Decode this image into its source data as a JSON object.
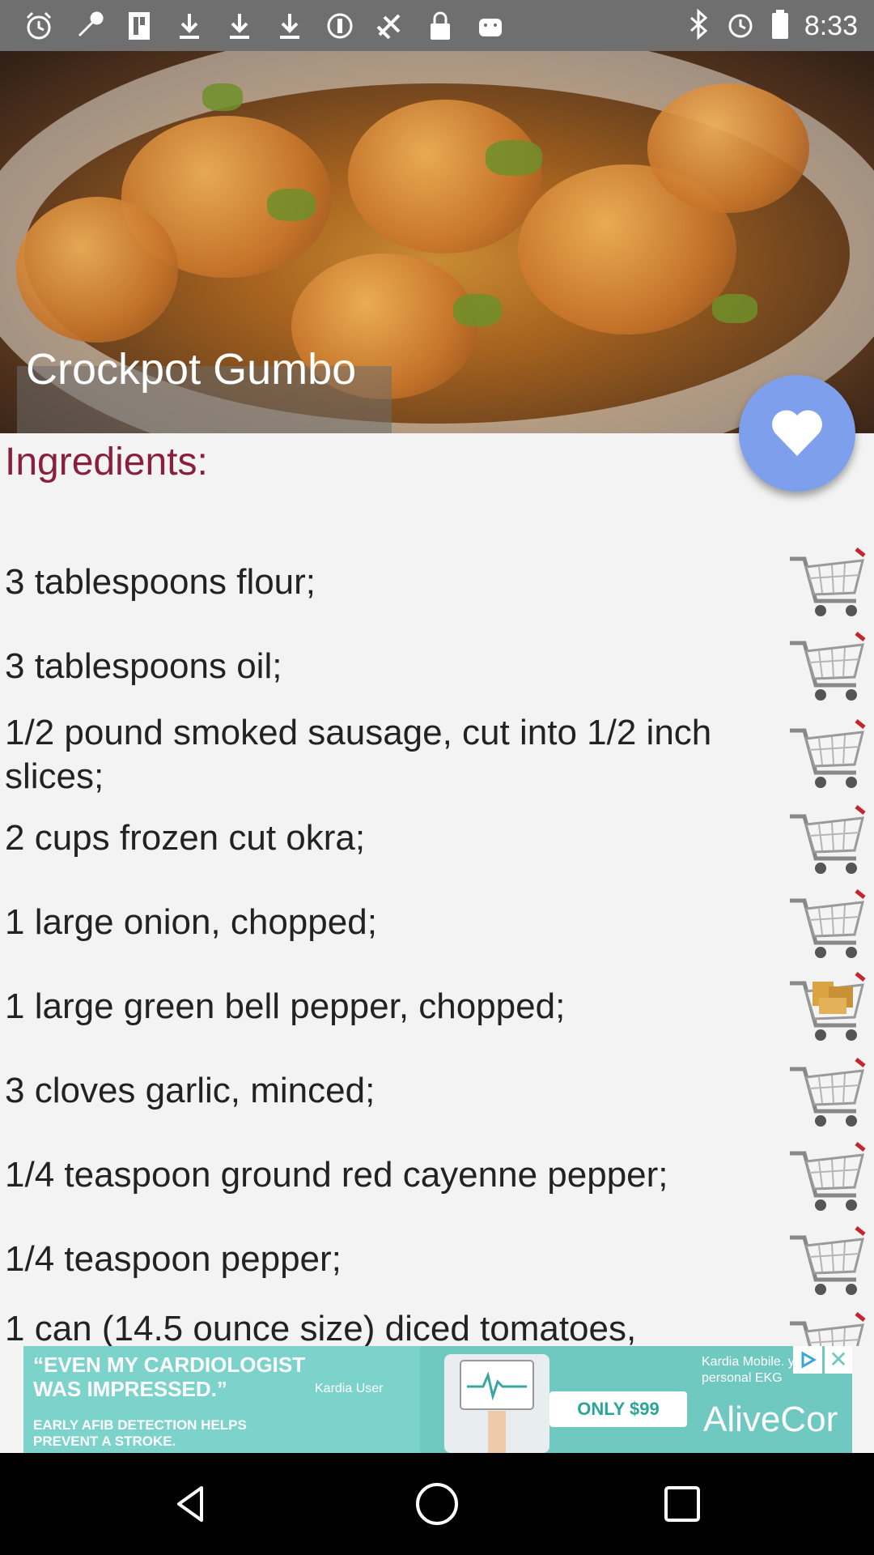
{
  "status_bar": {
    "time": "8:33",
    "icons": [
      "alarm-icon",
      "wrench-icon",
      "file-icon",
      "download-icon",
      "download-icon",
      "download-icon",
      "sync-icon",
      "fake-gps-icon",
      "lock-icon",
      "android-icon"
    ],
    "right_icons": [
      "bluetooth-icon",
      "alarm-icon",
      "battery-icon"
    ]
  },
  "hero": {
    "title": "Crockpot Gumbo",
    "favorite_icon": "heart-icon",
    "favorite_color": "#7ea0ec"
  },
  "ingredients": {
    "heading": "Ingredients:",
    "heading_color": "#8a1f3c",
    "items": [
      {
        "text": "3 tablespoons flour;",
        "icon": "shopping-cart-icon"
      },
      {
        "text": "3 tablespoons oil;",
        "icon": "shopping-cart-icon"
      },
      {
        "text": "1/2 pound smoked sausage, cut into 1/2 inch slices;",
        "icon": "shopping-cart-icon"
      },
      {
        "text": "2 cups frozen cut okra;",
        "icon": "shopping-cart-icon"
      },
      {
        "text": "1 large onion, chopped;",
        "icon": "shopping-cart-icon"
      },
      {
        "text": "1 large green bell pepper, chopped;",
        "icon": "full-shopping-cart-icon"
      },
      {
        "text": "3 cloves garlic, minced;",
        "icon": "shopping-cart-icon"
      },
      {
        "text": "1/4 teaspoon ground red cayenne pepper;",
        "icon": "shopping-cart-icon"
      },
      {
        "text": "1/4 teaspoon pepper;",
        "icon": "shopping-cart-icon"
      },
      {
        "text": "1 can (14.5 ounce size) diced tomatoes,",
        "icon": "shopping-cart-icon"
      }
    ]
  },
  "ad": {
    "headline": "“EVEN MY CARDIOLOGIST WAS IMPRESSED.”",
    "attribution": "Kardia User",
    "small_text": "EARLY AFIB DETECTION HELPS PREVENT A STROKE.",
    "price": "ONLY $99",
    "brand": "AliveCor",
    "side_text": "Kardia Mobile. your personal EKG"
  },
  "nav": {
    "back": "back-icon",
    "home": "home-icon",
    "recents": "recents-icon"
  }
}
